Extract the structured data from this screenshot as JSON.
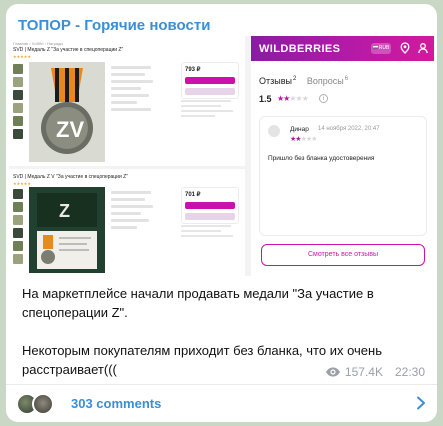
{
  "channel": {
    "title": "ТОПОР - Горячие новости"
  },
  "media": {
    "shot1": {
      "crumbs": "Главная › Хобби › Награды",
      "title": "SVD | Медаль Z \"За участие в спецоперации Z\"",
      "rating_stars": "★★★★★",
      "price": "793 ₽"
    },
    "shot2": {
      "title": "SVD | Медаль Z V \"За участие в спецоперации Z\"",
      "rating_stars": "★★★★★",
      "price": "701 ₽"
    },
    "wb": {
      "logo": "WILDBERRIES",
      "currency": "RUB",
      "tabs": [
        {
          "label": "Отзывы",
          "count": "2"
        },
        {
          "label": "Вопросы",
          "count": "6"
        }
      ],
      "rating_value": "1.5",
      "review": {
        "author": "Динар",
        "date": "14 ноября 2022, 20:47",
        "text": "Пришло без бланка удостоверения"
      },
      "all_reviews_label": "Смотреть все отзывы"
    }
  },
  "caption": {
    "line1": "На маркетплейсе начали продавать медали \"За участие в спецоперации Z\".",
    "line2": "Некоторым покупателям приходит без бланка, что их очень расстраивает((("
  },
  "meta": {
    "views": "157.4K",
    "time": "22:30"
  },
  "comments": {
    "label": "303 comments"
  },
  "colors": {
    "accent": "#3a8fd6",
    "wb_brand": "#cb11ab"
  }
}
